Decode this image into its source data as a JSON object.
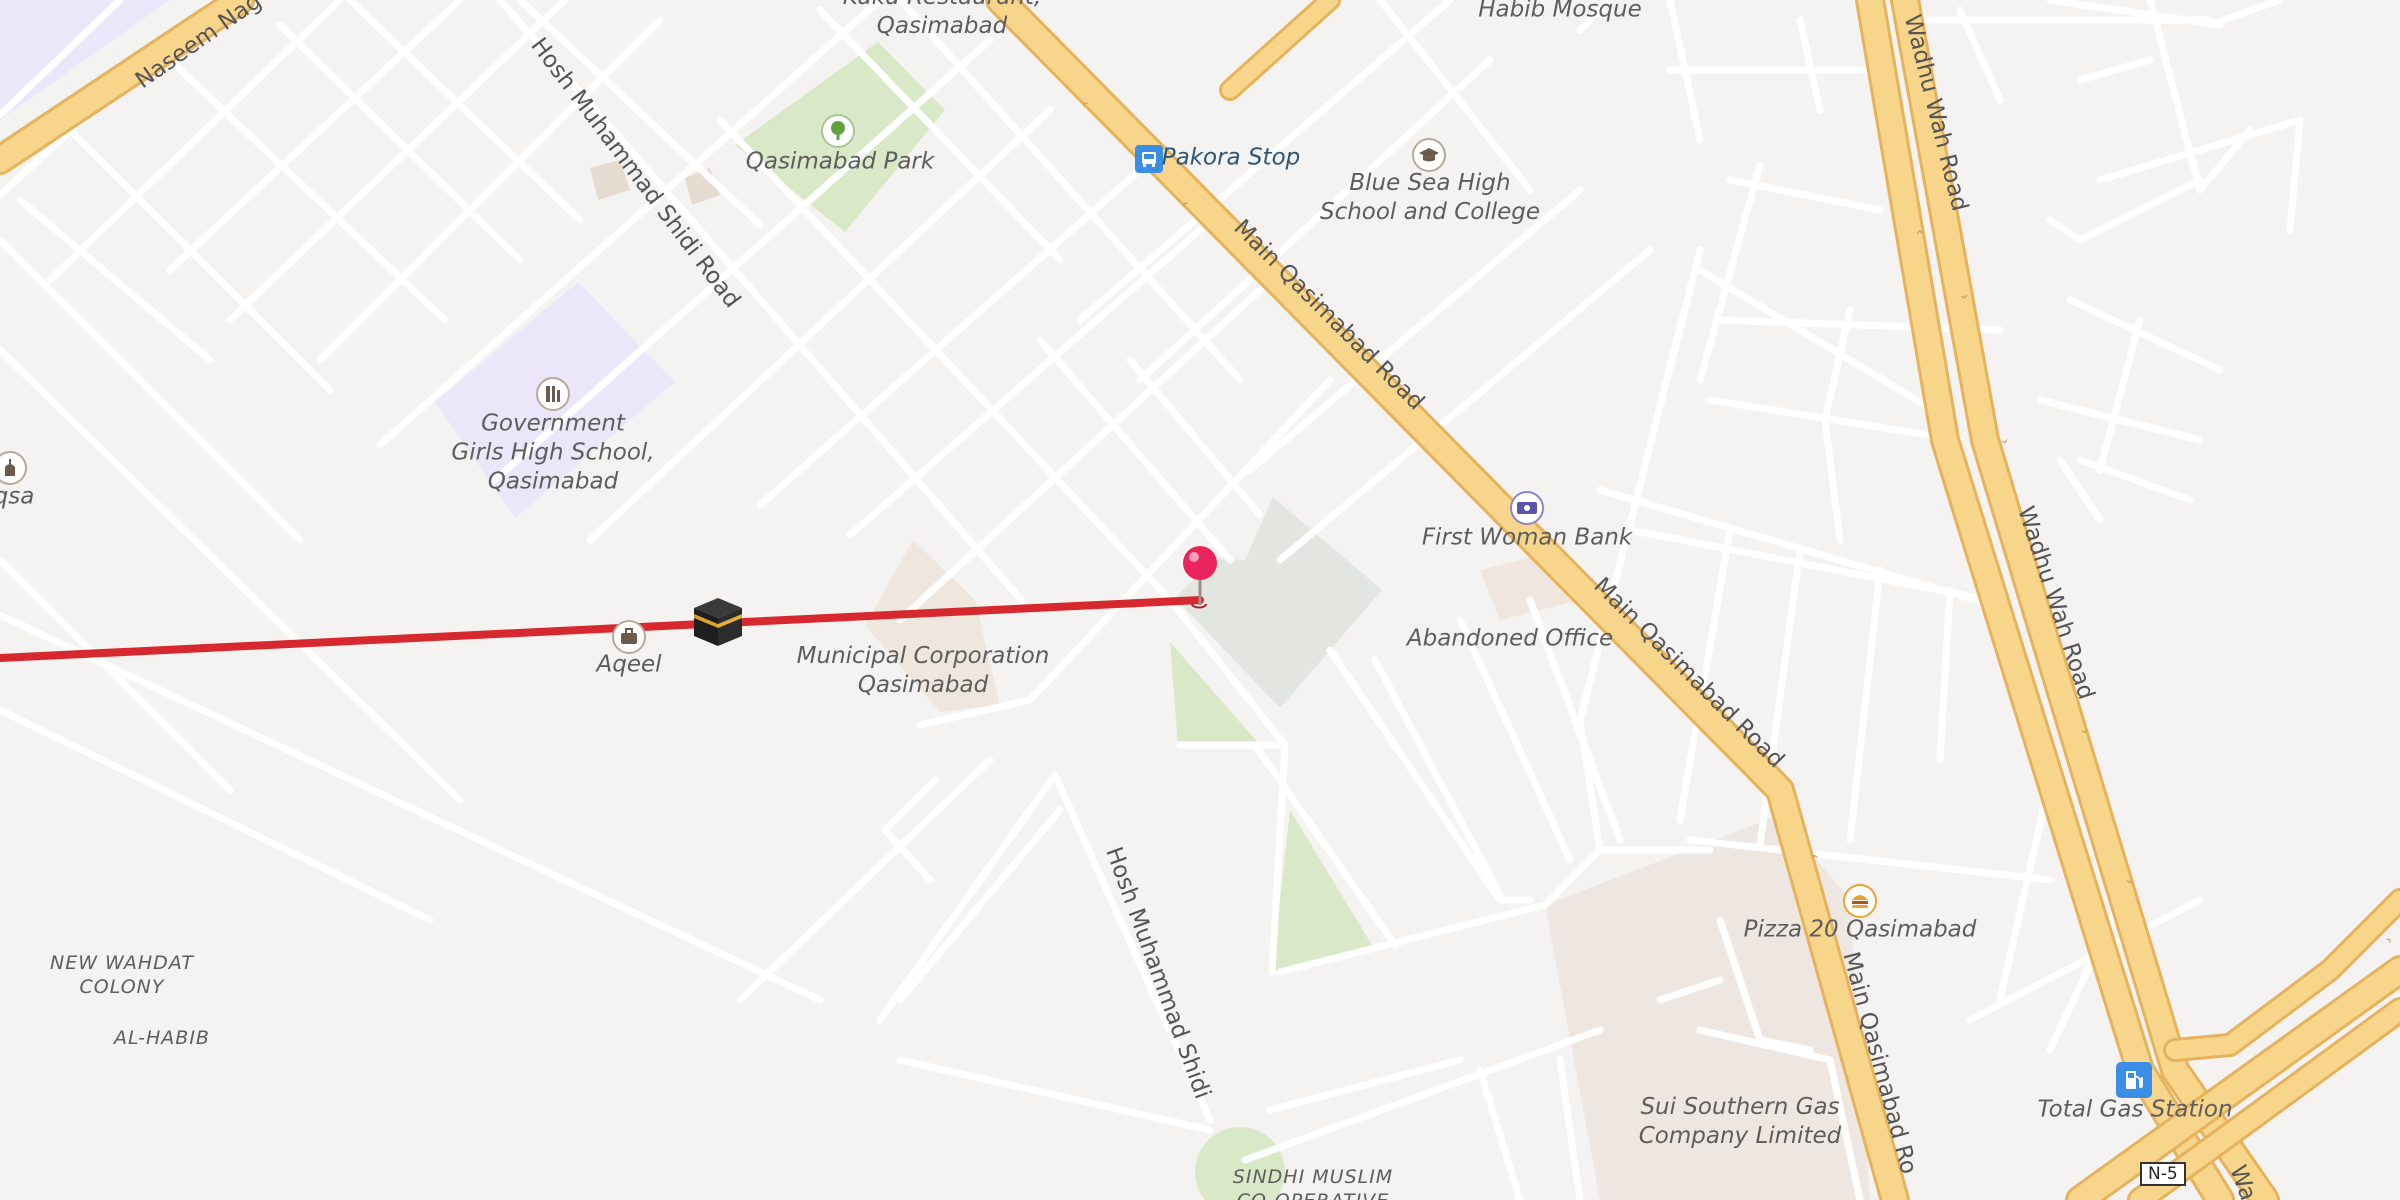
{
  "streets": {
    "naseem_nagar": "Naseem Nag",
    "hosh_shidi_north": "Hosh Muhammad Shidi Road",
    "hosh_shidi_south": "Hosh Muhammad Shidi",
    "main_qasimabad_1": "Main Qasimabad Road",
    "main_qasimabad_2": "Main Qasimabad Road",
    "main_qasimabad_3": "Main Qasimabad Ro",
    "wadhu_wah_1": "Wadhu Wah Road",
    "wadhu_wah_2": "Wadhu Wah Road",
    "wadhu_wah_3": "Wa",
    "highway_shield": "N-5"
  },
  "places": {
    "kuku_restaurant": "Kuku Restaurant,\nQasimabad",
    "habib_mosque": "Habib Mosque",
    "qasimabad_park": "Qasimabad Park",
    "pakora_stop": "Pakora Stop",
    "blue_sea_school": "Blue Sea High\nSchool and College",
    "govt_girls_school": "Government\nGirls High School,\nQasimabad",
    "aqsa": "qsa",
    "first_woman_bank": "First Woman Bank",
    "abandoned_office": "Abandoned Office",
    "aqeel": "Aqeel",
    "municipal_corporation": "Municipal Corporation\nQasimabad",
    "pizza_20": "Pizza 20 Qasimabad",
    "sui_southern_gas": "Sui Southern Gas\nCompany Limited",
    "total_gas_station": "Total Gas Station",
    "sindhi_muslim": "SINDHI MUSLIM\nCO-OPERATIVE"
  },
  "areas": {
    "new_wahdat": "NEW WAHDAT\nCOLONY",
    "al_habib": "AL-HABIB"
  },
  "icons": {
    "park": "tree-icon",
    "bus": "bus-stop-icon",
    "school": "graduation-cap-icon",
    "govt_school": "school-building-icon",
    "bank": "banknote-icon",
    "pizza": "burger-icon",
    "fuel": "fuel-pump-icon",
    "mosque": "mosque-icon",
    "office": "briefcase-icon",
    "kaaba": "kaaba-icon",
    "pin": "location-pin-icon"
  },
  "colors": {
    "background": "#f5f3f1",
    "major_road": "#f7d58a",
    "major_road_edge": "#e6b35c",
    "minor_road": "#ffffff",
    "park": "#d9e9c8",
    "school_area": "#ece6fa",
    "route_line": "#d8282f",
    "pin": "#e8245a",
    "transit_label": "#2c5678"
  }
}
